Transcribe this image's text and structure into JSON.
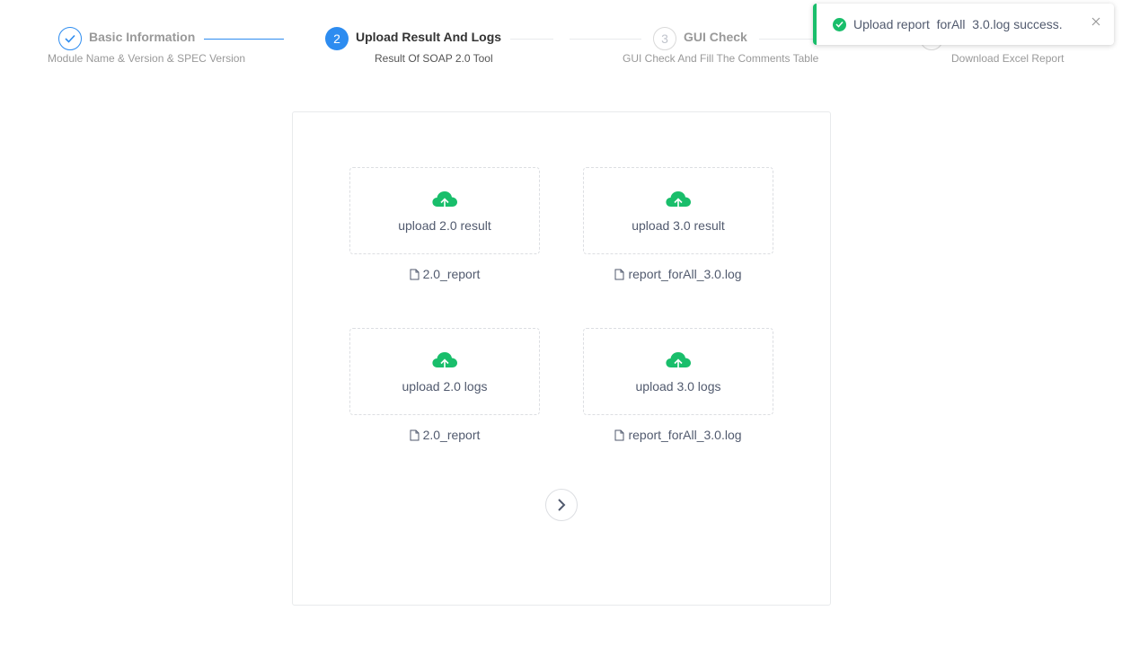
{
  "steps": [
    {
      "number": "",
      "title": "Basic Information",
      "description": "Module Name & Version & SPEC Version",
      "status": "done"
    },
    {
      "number": "2",
      "title": "Upload Result And Logs",
      "description": "Result Of SOAP 2.0 Tool",
      "status": "active"
    },
    {
      "number": "3",
      "title": "GUI Check",
      "description": "GUI Check And Fill The Comments Table",
      "status": "wait"
    },
    {
      "number": "4",
      "title": "",
      "description": "Download Excel Report",
      "status": "wait"
    }
  ],
  "uploads": [
    {
      "label": "upload 2.0 result",
      "file": "2.0_report"
    },
    {
      "label": "upload 3.0 result",
      "file": "report_forAll_3.0.log"
    },
    {
      "label": "upload 2.0 logs",
      "file": "2.0_report"
    },
    {
      "label": "upload 3.0 logs",
      "file": "report_forAll_3.0.log"
    }
  ],
  "toast": {
    "message": "Upload report  forAll  3.0.log success."
  },
  "colors": {
    "primary": "#2d8cf0",
    "success": "#19be6b",
    "muted": "#999999"
  },
  "icons": {
    "upload": "cloud-upload-icon",
    "file": "file-icon",
    "next": "chevron-right-icon",
    "check": "check-icon",
    "close": "close-icon"
  }
}
